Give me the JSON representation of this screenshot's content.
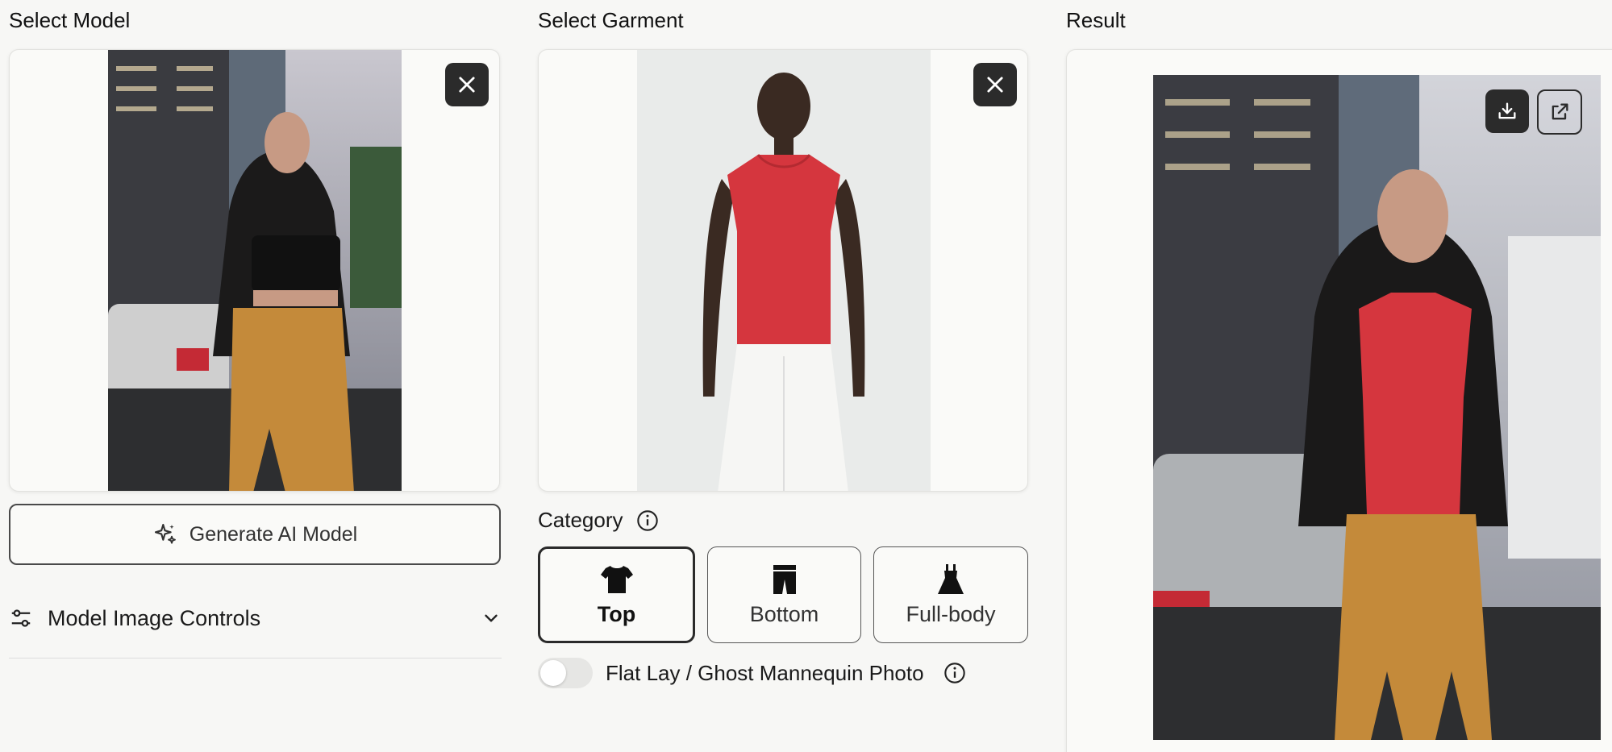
{
  "columns": {
    "model_title": "Select Model",
    "garment_title": "Select Garment",
    "result_title": "Result"
  },
  "model_panel": {
    "generate_button_label": "Generate AI Model",
    "controls_label": "Model Image Controls"
  },
  "garment_panel": {
    "category_label": "Category",
    "categories": [
      {
        "label": "Top",
        "selected": true
      },
      {
        "label": "Bottom",
        "selected": false
      },
      {
        "label": "Full-body",
        "selected": false
      }
    ],
    "flat_lay_label": "Flat Lay / Ghost Mannequin Photo",
    "flat_lay_enabled": false
  },
  "icons": {
    "close": "close-icon",
    "sparkle": "sparkle-icon",
    "sliders": "sliders-icon",
    "chevron": "chevron-down-icon",
    "info": "info-icon",
    "download": "download-icon",
    "external": "external-link-icon"
  },
  "colors": {
    "garment_red": "#d5363e",
    "skirt_mustard": "#c48a3a",
    "dark_button": "#2b2b2b"
  }
}
